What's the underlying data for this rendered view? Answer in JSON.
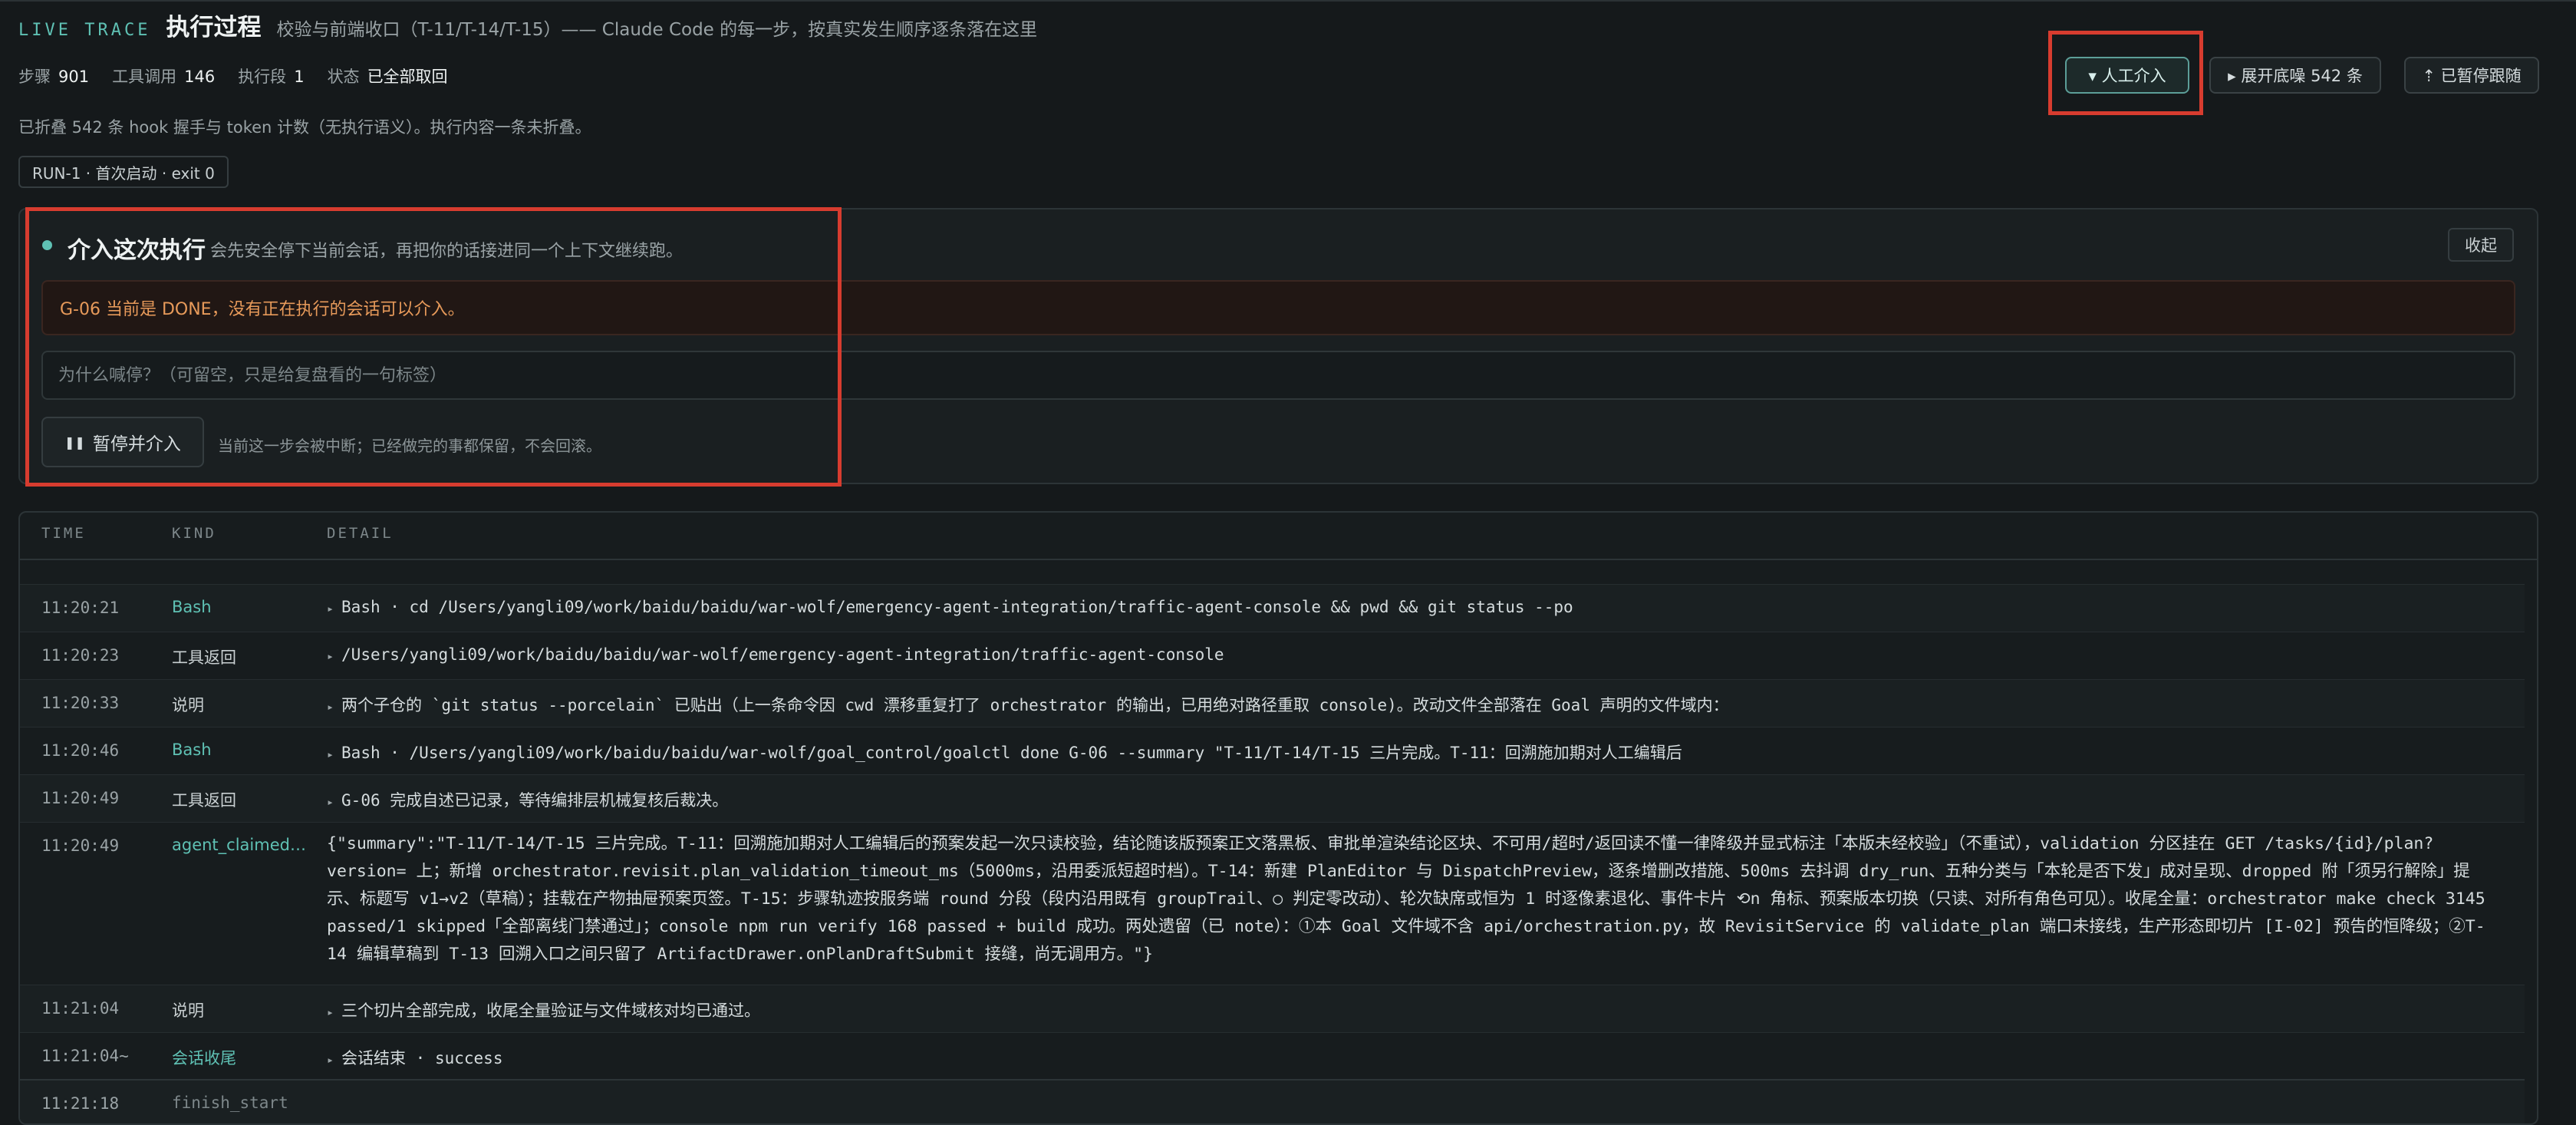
{
  "header": {
    "brand": "LIVE TRACE",
    "title": "执行过程",
    "subtitle": "校验与前端收口（T-11/T-14/T-15）—— Claude Code 的每一步，按真实发生顺序逐条落在这里"
  },
  "stats": [
    {
      "label": "步骤",
      "value": "901"
    },
    {
      "label": "工具调用",
      "value": "146"
    },
    {
      "label": "执行段",
      "value": "1"
    },
    {
      "label": "状态",
      "value": "已全部取回"
    }
  ],
  "toolbar": {
    "intervene_label": "▾ 人工介入",
    "expand_noise_label": "▸ 展开底噪 542 条",
    "pause_follow_label": "⇡ 已暂停跟随"
  },
  "fold_note": "已折叠 542 条 hook 握手与 token 计数（无执行语义）。执行内容一条未折叠。",
  "run_tag": "RUN-1 · 首次启动 · exit 0",
  "intervene_panel": {
    "title": "介入这次执行",
    "description": "会先安全停下当前会话，再把你的话接进同一个上下文继续跑。",
    "collapse_label": "收起",
    "warning": "G-06 当前是 DONE，没有正在执行的会话可以介入。",
    "reason_value": "",
    "reason_placeholder": "为什么喊停？（可留空，只是给复盘看的一句标签）",
    "pause_button_label": "暂停并介入",
    "pause_note": "当前这一步会被中断；已经做完的事都保留，不会回滚。"
  },
  "table": {
    "columns": [
      "TIME",
      "KIND",
      "DETAIL"
    ],
    "rows": [
      {
        "time": "11:20:21",
        "kind": "Bash",
        "detail": "Bash · cd /Users/yangli09/work/baidu/baidu/war-wolf/emergency-agent-integration/traffic-agent-console && pwd && git status --po"
      },
      {
        "time": "11:20:23",
        "kind": "工具返回",
        "detail": "/Users/yangli09/work/baidu/baidu/war-wolf/emergency-agent-integration/traffic-agent-console"
      },
      {
        "time": "11:20:33",
        "kind": "说明",
        "detail": "两个子仓的 `git status --porcelain` 已贴出（上一条命令因 cwd 漂移重复打了 orchestrator 的输出，已用绝对路径重取 console)。改动文件全部落在 Goal 声明的文件域内："
      },
      {
        "time": "11:20:46",
        "kind": "Bash",
        "detail": "Bash · /Users/yangli09/work/baidu/baidu/war-wolf/goal_control/goalctl done G-06 --summary \"T-11/T-14/T-15 三片完成。T-11：回溯施加期对人工编辑后"
      },
      {
        "time": "11:20:49",
        "kind": "工具返回",
        "detail": "G-06 完成自述已记录，等待编排层机械复核后裁决。"
      },
      {
        "time": "11:20:49",
        "kind": "agent_claimed_done",
        "detail": "{\"summary\":\"T-11/T-14/T-15 三片完成。T-11：回溯施加期对人工编辑后的预案发起一次只读校验，结论随该版预案正文落黑板、审批单渲染结论区块、不可用/超时/返回读不懂一律降级并显式标注「本版未经校验」（不重试），validation 分区挂在 GET /tasks/{id}/plan?version= 上；新增 orchestrator.revisit.plan_validation_timeout_ms（5000ms，沿用委派短超时档）。T-14：新建 PlanEditor 与 DispatchPreview，逐条增删改措施、500ms 去抖调 dry_run、五种分类与「本轮是否下发」成对呈现、dropped 附「须另行解除」提示、标题写 v1→v2（草稿）；挂载在产物抽屉预案页签。T-15：步骤轨迹按服务端 round 分段（段内沿用既有 groupTrail、○ 判定零改动）、轮次缺席或恒为 1 时逐像素退化、事件卡片 ⟲n 角标、预案版本切换（只读、对所有角色可见）。收尾全量：orchestrator make check 3145 passed/1 skipped「全部离线门禁通过」；console npm run verify 168 passed + build 成功。两处遗留（已 note）：①本 Goal 文件域不含 api/orchestration.py，故 RevisitService 的 validate_plan 端口未接线，生产形态即切片 [I-02] 预告的恒降级；②T-14 编辑草稿到 T-13 回溯入口之间只留了 ArtifactDrawer.onPlanDraftSubmit 接缝，尚无调用方。\"}"
      },
      {
        "time": "11:21:04",
        "kind": "说明",
        "detail": "三个切片全部完成，收尾全量验证与文件域核对均已通过。"
      },
      {
        "time": "11:21:04~",
        "kind": "会话收尾",
        "detail": "会话结束 · success"
      },
      {
        "time": "11:21:18",
        "kind": "finish_start",
        "detail": ""
      }
    ]
  },
  "colors": {
    "accent": "#5fc1b4",
    "background": "#15191b",
    "warning_text": "#e79a5a",
    "highlight": "#d73c2f"
  }
}
